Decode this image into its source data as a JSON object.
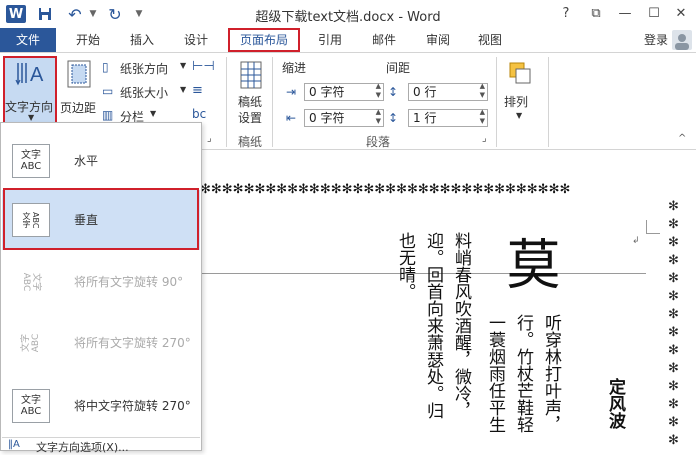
{
  "window": {
    "title": "超级下载text文档.docx - Word",
    "help": "?",
    "restore": "⧉",
    "minimize": "—",
    "maximize": "☐",
    "close": "✕"
  },
  "quick_access": {
    "logo": "W",
    "save": "💾",
    "undo": "↶",
    "redo": "↻"
  },
  "tabs": {
    "file": "文件",
    "home": "开始",
    "insert": "插入",
    "design": "设计",
    "layout": "页面布局",
    "references": "引用",
    "mailings": "邮件",
    "review": "审阅",
    "view": "视图",
    "login": "登录"
  },
  "ribbon": {
    "text_direction": "文字方向",
    "margins": "页边距",
    "orientation": "纸张方向",
    "size": "纸张大小",
    "columns": "分栏",
    "manuscript_line1": "稿纸",
    "manuscript_line2": "设置",
    "manuscript_group": "稿纸",
    "indent": "缩进",
    "spacing": "间距",
    "indent_left": "0 字符",
    "indent_right": "0 字符",
    "spacing_before": "0 行",
    "spacing_after": "1 行",
    "paragraph_group": "段落",
    "arrange": "排列"
  },
  "dropdown": {
    "horizontal": "水平",
    "vertical": "垂直",
    "rotate90": "将所有文字旋转 90°",
    "rotate270": "将所有文字旋转 270°",
    "rotate_asian270": "将中文字符旋转 270°",
    "options": "文字方向选项(X)...",
    "icon_text": "文字",
    "icon_abc": "ABC"
  },
  "document": {
    "title_char": "莫",
    "poem_title": "定风波",
    "col1": "听穿林打叶声，",
    "col2": "行。竹杖芒鞋轻",
    "col3": "一蓑烟雨任平生",
    "col4": "料峭春风吹酒醒，微冷，",
    "col5": "迎。回首向来萧瑟处。归",
    "col6": "也无晴。"
  }
}
